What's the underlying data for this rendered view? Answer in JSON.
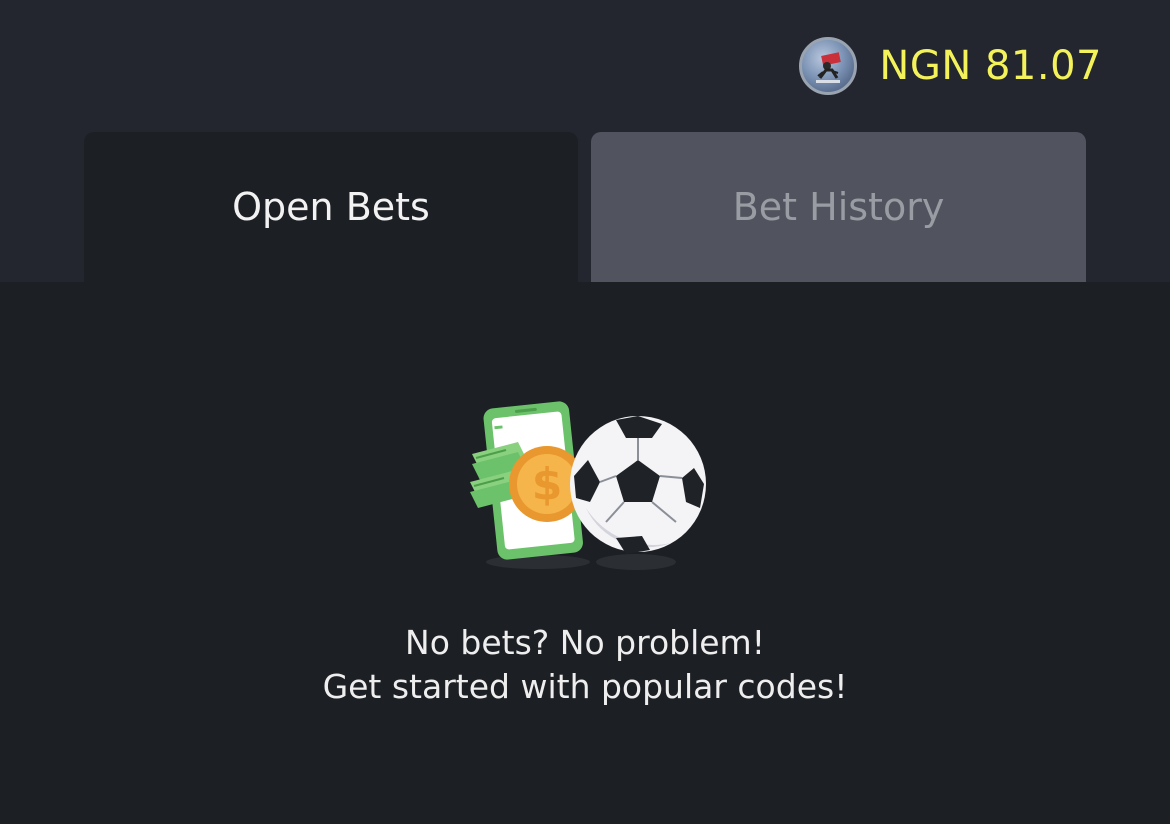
{
  "header": {
    "avatar_icon": "user-avatar-icon",
    "balance": "NGN 81.07",
    "balance_color": "#f4f25a"
  },
  "tabs": [
    {
      "label": "Open Bets",
      "active": true
    },
    {
      "label": "Bet History",
      "active": false
    }
  ],
  "empty_state": {
    "illustration_icon": "money-phone-football-icon",
    "line1": "No bets? No problem!",
    "line2": "Get started with popular codes!"
  },
  "colors": {
    "background": "#1c1f24",
    "header_background": "#23262e",
    "inactive_tab": "#51545e",
    "money_green": "#6cc26a",
    "coin_orange": "#f2a63a"
  }
}
